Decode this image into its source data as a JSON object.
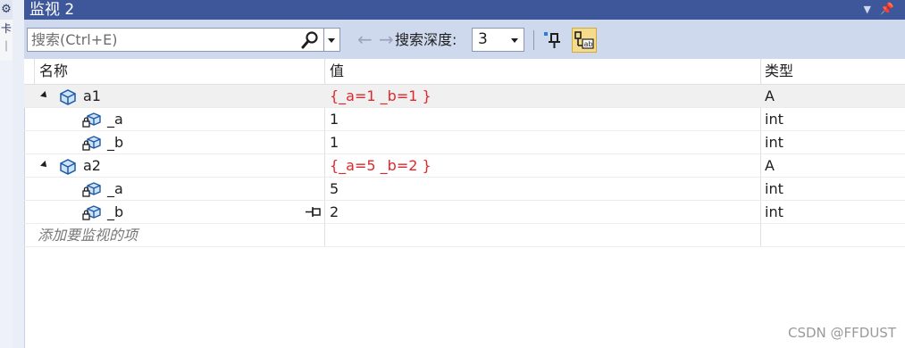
{
  "window": {
    "title": "监视 2"
  },
  "toolbar": {
    "search_placeholder": "搜索(Ctrl+E)",
    "search_depth_label": "搜索深度:",
    "search_depth_value": "3"
  },
  "columns": {
    "name": "名称",
    "value": "值",
    "type": "类型"
  },
  "rows": [
    {
      "name": "a1",
      "value": "{_a=1 _b=1 }",
      "type": "A"
    },
    {
      "name": "_a",
      "value": "1",
      "type": "int"
    },
    {
      "name": "_b",
      "value": "1",
      "type": "int"
    },
    {
      "name": "a2",
      "value": "{_a=5 _b=2 }",
      "type": "A"
    },
    {
      "name": "_a",
      "value": "5",
      "type": "int"
    },
    {
      "name": "_b",
      "value": "2",
      "type": "int"
    }
  ],
  "add_item_placeholder": "添加要监视的项",
  "watermark": "CSDN @FFDUST",
  "colors": {
    "titlebar": "#3e569a",
    "toolbar": "#cfd9ee",
    "changed_value": "#e0272c",
    "active_button": "#f5dc8c"
  },
  "icons": [
    "gear-icon",
    "search-icon",
    "back-arrow-icon",
    "forward-arrow-icon",
    "pin-icon",
    "hex-display-icon",
    "object-icon",
    "private-field-icon",
    "expander-icon",
    "pin-to-source-icon"
  ]
}
